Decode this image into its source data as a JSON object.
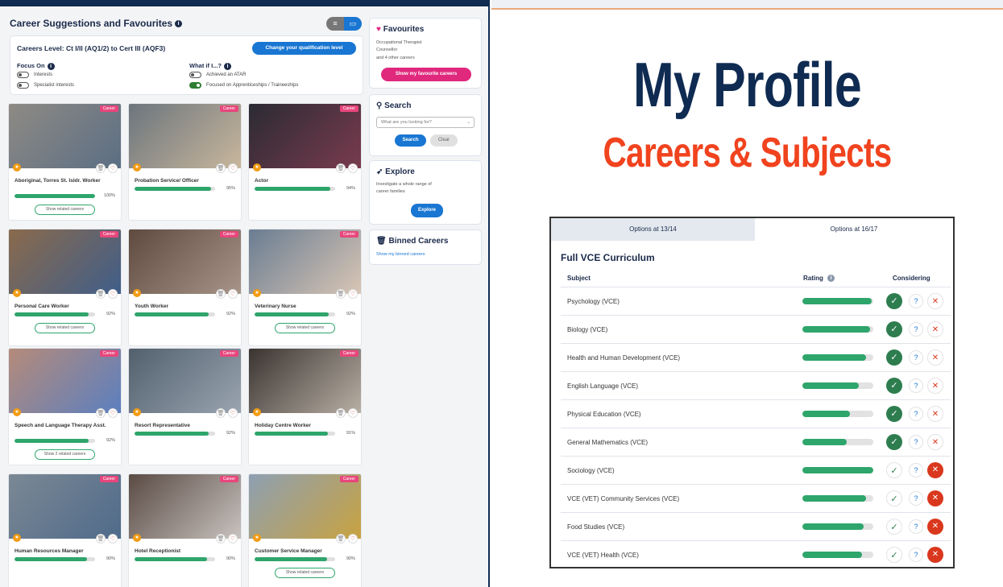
{
  "left": {
    "title": "Career Suggestions and Favourites",
    "info_icon": "i",
    "view_toggle": {
      "list_icon": "≡",
      "grid_icon": "▭"
    },
    "level": {
      "text": "Careers Level: Ct I/II (AQ1/2) to Cert III (AQF3)",
      "button": "Change your qualification level"
    },
    "focus_on": {
      "heading": "Focus On",
      "toggles": [
        "Interests",
        "Specialist interests"
      ]
    },
    "what_if": {
      "heading": "What if I...?",
      "toggles": [
        "Achieved an ATAR",
        "Focused on Apprenticeships / Traineeships"
      ]
    },
    "career_tag": "Career",
    "related_label": "Show related careers",
    "related_label_alt": "Show 2 related careers",
    "careers": [
      {
        "name": "Aboriginal, Torres St. Isldr. Worker",
        "pct": "100%",
        "value": 100,
        "related": true
      },
      {
        "name": "Probation Service/ Officer",
        "pct": "95%",
        "value": 95,
        "related": false
      },
      {
        "name": "Actor",
        "pct": "94%",
        "value": 94,
        "related": false
      },
      {
        "name": "Personal Care Worker",
        "pct": "92%",
        "value": 92,
        "related": true
      },
      {
        "name": "Youth Worker",
        "pct": "92%",
        "value": 92,
        "related": false
      },
      {
        "name": "Veterinary Nurse",
        "pct": "92%",
        "value": 92,
        "related": true
      },
      {
        "name": "Speech and Language Therapy Asst.",
        "pct": "92%",
        "value": 92,
        "related": true
      },
      {
        "name": "Resort Representative",
        "pct": "92%",
        "value": 92,
        "related": false
      },
      {
        "name": "Holiday Centre Worker",
        "pct": "91%",
        "value": 91,
        "related": false
      },
      {
        "name": "Human Resources Manager",
        "pct": "90%",
        "value": 90,
        "related": false
      },
      {
        "name": "Hotel Receptionist",
        "pct": "90%",
        "value": 90,
        "related": false
      },
      {
        "name": "Customer Service Manager",
        "pct": "90%",
        "value": 90,
        "related": true
      }
    ],
    "favourites": {
      "heading": "Favourites",
      "line1": "Occupational Therapist",
      "line2": "Counsellor",
      "line3": "and 4 other careers",
      "button": "Show my favourite careers"
    },
    "search": {
      "heading": "Search",
      "placeholder": "What are you looking for?",
      "search_btn": "Search",
      "clear_btn": "Clear"
    },
    "explore": {
      "heading": "Explore",
      "text1": "Investigate a whole range of",
      "text2": "career families",
      "button": "Explore"
    },
    "binned": {
      "heading": "Binned Careers",
      "link": "Show my binned careers"
    }
  },
  "right": {
    "heading": "My Profile",
    "subheading": "Careers & Subjects",
    "tabs": [
      "Options at 13/14",
      "Options at 16/17"
    ],
    "panel_title": "Full VCE Curriculum",
    "columns": {
      "subject": "Subject",
      "rating": "Rating",
      "considering": "Considering"
    },
    "subjects": [
      {
        "name": "Psychology (VCE)",
        "rating": 0.98,
        "status": "yes"
      },
      {
        "name": "Biology (VCE)",
        "rating": 0.96,
        "status": "yes"
      },
      {
        "name": "Health and Human Development (VCE)",
        "rating": 0.9,
        "status": "yes"
      },
      {
        "name": "English Language (VCE)",
        "rating": 0.79,
        "status": "yes"
      },
      {
        "name": "Physical Education (VCE)",
        "rating": 0.67,
        "status": "yes"
      },
      {
        "name": "General Mathematics (VCE)",
        "rating": 0.63,
        "status": "yes"
      },
      {
        "name": "Sociology (VCE)",
        "rating": 1.0,
        "status": "no"
      },
      {
        "name": "VCE (VET) Community Services (VCE)",
        "rating": 0.9,
        "status": "no"
      },
      {
        "name": "Food Studies (VCE)",
        "rating": 0.86,
        "status": "no"
      },
      {
        "name": "VCE (VET) Health (VCE)",
        "rating": 0.84,
        "status": "no"
      }
    ],
    "icons": {
      "check": "✓",
      "question": "?",
      "cross": "✕"
    },
    "colors": {
      "navy": "#0f2b52",
      "orange": "#f0431e",
      "green": "#2ea56b",
      "darkgreen": "#2e7d4f",
      "red": "#d9381e"
    }
  }
}
